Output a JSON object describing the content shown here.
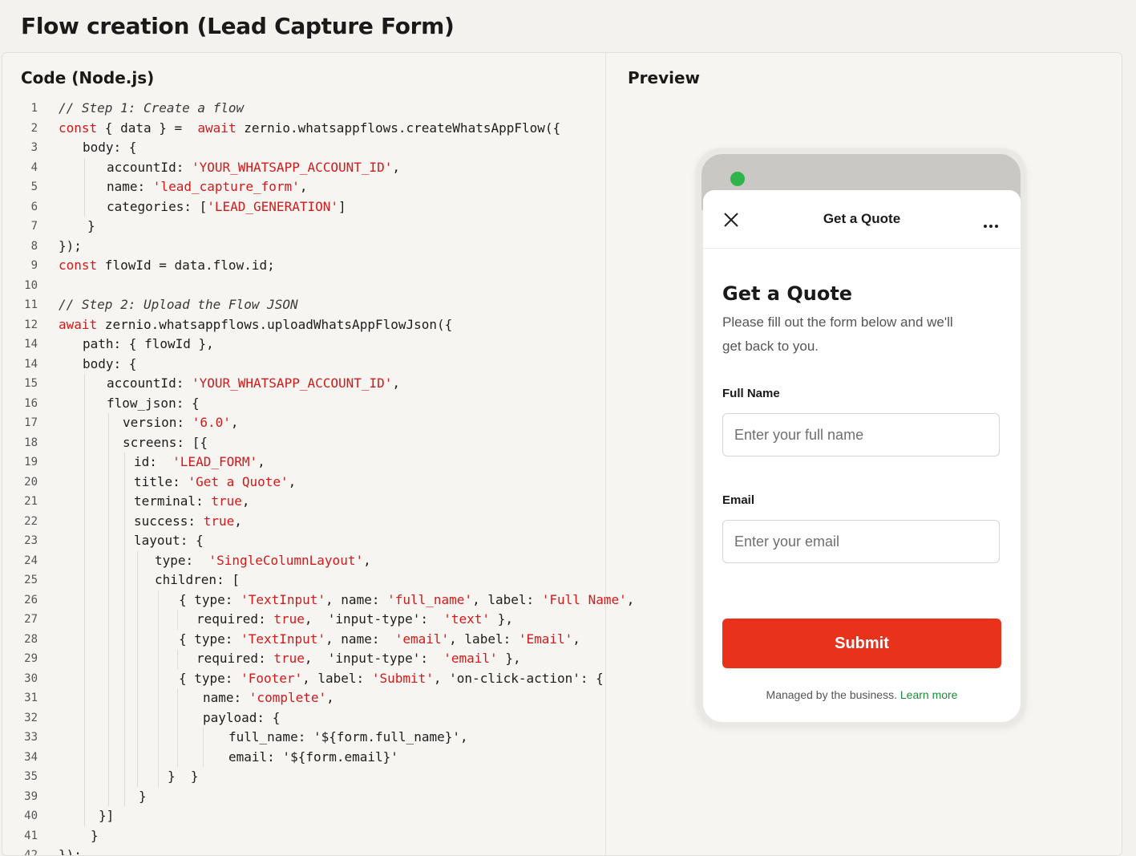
{
  "page": {
    "title": "Flow creation (Lead Capture Form)"
  },
  "code_panel": {
    "title": "Code (Node.js)",
    "lines": [
      {
        "n": "1",
        "indent": 0,
        "guides": [],
        "tokens": [
          [
            "cm",
            "// Step 1: Create a flow"
          ]
        ]
      },
      {
        "n": "2",
        "indent": 0,
        "guides": [],
        "tokens": [
          [
            "kw",
            "const"
          ],
          [
            "p",
            " { data } =  "
          ],
          [
            "kw",
            "await"
          ],
          [
            "p",
            " zernio.whatsappflows.createWhatsAppFlow({"
          ]
        ]
      },
      {
        "n": "3",
        "indent": 30,
        "guides": [],
        "tokens": [
          [
            "p",
            "body: {"
          ]
        ]
      },
      {
        "n": "4",
        "indent": 60,
        "guides": [
          32
        ],
        "tokens": [
          [
            "p",
            "accountId: "
          ],
          [
            "str",
            "'YOUR_WHATSAPP_ACCOUNT_ID'"
          ],
          [
            "p",
            ","
          ]
        ]
      },
      {
        "n": "5",
        "indent": 60,
        "guides": [
          32
        ],
        "tokens": [
          [
            "p",
            "name: "
          ],
          [
            "str",
            "'lead_capture_form'"
          ],
          [
            "p",
            ","
          ]
        ]
      },
      {
        "n": "6",
        "indent": 60,
        "guides": [
          32
        ],
        "tokens": [
          [
            "p",
            "categories: ["
          ],
          [
            "str",
            "'LEAD_GENERATION'"
          ],
          [
            "p",
            "]"
          ]
        ]
      },
      {
        "n": "7",
        "indent": 36,
        "guides": [],
        "tokens": [
          [
            "p",
            "}"
          ]
        ]
      },
      {
        "n": "8",
        "indent": 0,
        "guides": [],
        "tokens": [
          [
            "p",
            "});"
          ]
        ]
      },
      {
        "n": "9",
        "indent": 0,
        "guides": [],
        "tokens": [
          [
            "kw",
            "const"
          ],
          [
            "p",
            " flowId = data.flow.id;"
          ]
        ]
      },
      {
        "n": "10",
        "indent": 0,
        "guides": [],
        "tokens": []
      },
      {
        "n": "11",
        "indent": 0,
        "guides": [],
        "tokens": [
          [
            "cm",
            "// Step 2: Upload the Flow JSON"
          ]
        ]
      },
      {
        "n": "12",
        "indent": 0,
        "guides": [],
        "tokens": [
          [
            "kw",
            "await"
          ],
          [
            "p",
            " zernio.whatsappflows.uploadWhatsAppFlowJson({"
          ]
        ]
      },
      {
        "n": "14",
        "indent": 30,
        "guides": [],
        "tokens": [
          [
            "p",
            "path: { flowId },"
          ]
        ]
      },
      {
        "n": "14",
        "indent": 30,
        "guides": [],
        "tokens": [
          [
            "p",
            "body: {"
          ]
        ]
      },
      {
        "n": "15",
        "indent": 60,
        "guides": [
          32
        ],
        "tokens": [
          [
            "p",
            "accountId: "
          ],
          [
            "str",
            "'YOUR_WHATSAPP_ACCOUNT_ID'"
          ],
          [
            "p",
            ","
          ]
        ]
      },
      {
        "n": "16",
        "indent": 60,
        "guides": [
          32
        ],
        "tokens": [
          [
            "p",
            "flow_json: {"
          ]
        ]
      },
      {
        "n": "17",
        "indent": 80,
        "guides": [
          32,
          62
        ],
        "tokens": [
          [
            "p",
            "version: "
          ],
          [
            "str",
            "'6.0'"
          ],
          [
            "p",
            ","
          ]
        ]
      },
      {
        "n": "18",
        "indent": 80,
        "guides": [
          32,
          62
        ],
        "tokens": [
          [
            "p",
            "screens: [{"
          ]
        ]
      },
      {
        "n": "19",
        "indent": 94,
        "guides": [
          32,
          62,
          82
        ],
        "tokens": [
          [
            "p",
            "id: "
          ],
          [
            "str",
            " 'LEAD_FORM'"
          ],
          [
            "p",
            ","
          ]
        ]
      },
      {
        "n": "20",
        "indent": 94,
        "guides": [
          32,
          62,
          82
        ],
        "tokens": [
          [
            "p",
            "title: "
          ],
          [
            "str",
            "'Get a Quote'"
          ],
          [
            "p",
            ","
          ]
        ]
      },
      {
        "n": "21",
        "indent": 94,
        "guides": [
          32,
          62,
          82
        ],
        "tokens": [
          [
            "p",
            "terminal: "
          ],
          [
            "kw",
            "true"
          ],
          [
            "p",
            ","
          ]
        ]
      },
      {
        "n": "22",
        "indent": 94,
        "guides": [
          32,
          62,
          82
        ],
        "tokens": [
          [
            "p",
            "success: "
          ],
          [
            "kw",
            "true"
          ],
          [
            "p",
            ","
          ]
        ]
      },
      {
        "n": "23",
        "indent": 94,
        "guides": [
          32,
          62,
          82
        ],
        "tokens": [
          [
            "p",
            "layout: {"
          ]
        ]
      },
      {
        "n": "24",
        "indent": 120,
        "guides": [
          32,
          62,
          82,
          98
        ],
        "tokens": [
          [
            "p",
            "type: "
          ],
          [
            "str",
            " 'SingleColumnLayout'"
          ],
          [
            "p",
            ","
          ]
        ]
      },
      {
        "n": "25",
        "indent": 120,
        "guides": [
          32,
          62,
          82,
          98
        ],
        "tokens": [
          [
            "p",
            "children: ["
          ]
        ]
      },
      {
        "n": "26",
        "indent": 150,
        "guides": [
          32,
          62,
          82,
          98,
          124
        ],
        "tokens": [
          [
            "p",
            "{ type: "
          ],
          [
            "str",
            "'TextInput'"
          ],
          [
            "p",
            ", name: "
          ],
          [
            "str",
            "'full_name'"
          ],
          [
            "p",
            ", label: "
          ],
          [
            "str",
            "'Full Name'"
          ],
          [
            "p",
            ","
          ]
        ]
      },
      {
        "n": "27",
        "indent": 172,
        "guides": [
          32,
          62,
          82,
          98,
          124,
          148
        ],
        "tokens": [
          [
            "p",
            "required: "
          ],
          [
            "kw",
            "true"
          ],
          [
            "p",
            ",  'input-type': "
          ],
          [
            "str",
            " 'text'"
          ],
          [
            "p",
            " },"
          ]
        ]
      },
      {
        "n": "28",
        "indent": 150,
        "guides": [
          32,
          62,
          82,
          98,
          124
        ],
        "tokens": [
          [
            "p",
            "{ type: "
          ],
          [
            "str",
            "'TextInput'"
          ],
          [
            "p",
            ", name: "
          ],
          [
            "str",
            " 'email'"
          ],
          [
            "p",
            ", label: "
          ],
          [
            "str",
            "'Email'"
          ],
          [
            "p",
            ","
          ]
        ]
      },
      {
        "n": "29",
        "indent": 172,
        "guides": [
          32,
          62,
          82,
          98,
          124,
          148
        ],
        "tokens": [
          [
            "p",
            "required: "
          ],
          [
            "kw",
            "true"
          ],
          [
            "p",
            ",  'input-type': "
          ],
          [
            "str",
            " 'email'"
          ],
          [
            "p",
            " },"
          ]
        ]
      },
      {
        "n": "30",
        "indent": 150,
        "guides": [
          32,
          62,
          82,
          98,
          124
        ],
        "tokens": [
          [
            "p",
            "{ type: "
          ],
          [
            "str",
            "'Footer'"
          ],
          [
            "p",
            ", label: "
          ],
          [
            "str",
            "'Submit'"
          ],
          [
            "p",
            ", 'on-click-action': {"
          ]
        ]
      },
      {
        "n": "31",
        "indent": 180,
        "guides": [
          32,
          62,
          82,
          98,
          124,
          148
        ],
        "tokens": [
          [
            "p",
            "name: "
          ],
          [
            "str",
            "'complete'"
          ],
          [
            "p",
            ","
          ]
        ]
      },
      {
        "n": "32",
        "indent": 180,
        "guides": [
          32,
          62,
          82,
          98,
          124,
          148
        ],
        "tokens": [
          [
            "p",
            "payload: {"
          ]
        ]
      },
      {
        "n": "33",
        "indent": 212,
        "guides": [
          32,
          62,
          82,
          98,
          124,
          148,
          180
        ],
        "tokens": [
          [
            "p",
            "full_name: '${form.full_name}',"
          ]
        ]
      },
      {
        "n": "34",
        "indent": 212,
        "guides": [
          32,
          62,
          82,
          98,
          124,
          148,
          180
        ],
        "tokens": [
          [
            "p",
            "email: '${form.email}'"
          ]
        ]
      },
      {
        "n": "35",
        "indent": 136,
        "guides": [
          32,
          62,
          82,
          98,
          124
        ],
        "tokens": [
          [
            "p",
            "}  }"
          ]
        ]
      },
      {
        "n": "39",
        "indent": 100,
        "guides": [
          32,
          62,
          82
        ],
        "tokens": [
          [
            "p",
            "}"
          ]
        ]
      },
      {
        "n": "40",
        "indent": 50,
        "guides": [
          32
        ],
        "tokens": [
          [
            "p",
            "}]"
          ]
        ]
      },
      {
        "n": "41",
        "indent": 40,
        "guides": [],
        "tokens": [
          [
            "p",
            "}"
          ]
        ]
      },
      {
        "n": "42",
        "indent": 0,
        "guides": [],
        "tokens": [
          [
            "p",
            "});"
          ]
        ]
      }
    ]
  },
  "preview_panel": {
    "title": "Preview",
    "status_dot_color": "#2fb34d",
    "header": {
      "title": "Get a Quote",
      "close_icon": "close-icon",
      "more_icon": "more-icon"
    },
    "form": {
      "heading": "Get a Quote",
      "description": "Please fill out the form below and we'll get back to you.",
      "fields": [
        {
          "label": "Full Name",
          "placeholder": "Enter your full name",
          "value": ""
        },
        {
          "label": "Email",
          "placeholder": "Enter your email",
          "value": ""
        }
      ],
      "submit_label": "Submit",
      "submit_color": "#e8321c"
    },
    "footer": {
      "text": "Managed by the business.",
      "link": "Learn more"
    }
  }
}
